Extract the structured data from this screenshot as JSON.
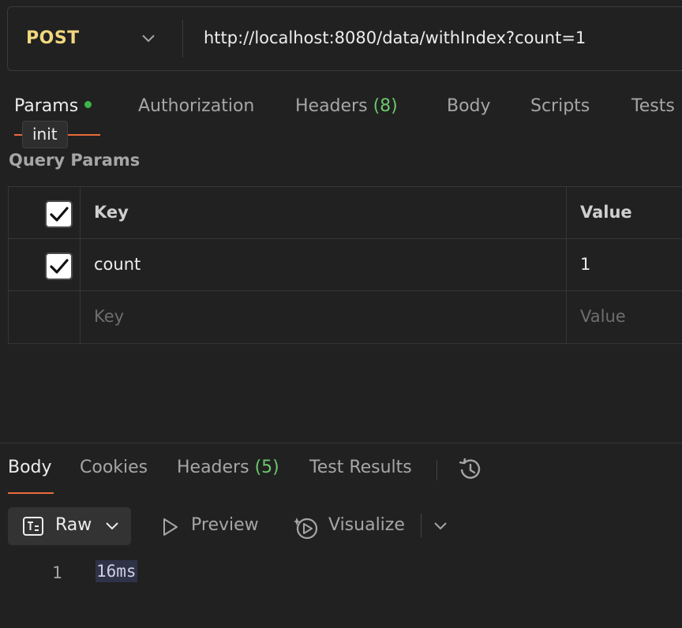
{
  "request": {
    "method": "POST",
    "url": "http://localhost:8080/data/withIndex?count=1"
  },
  "request_tabs": [
    {
      "label": "Params",
      "active": true,
      "has_dot": true
    },
    {
      "label": "Authorization"
    },
    {
      "label": "Headers",
      "count": "(8)"
    },
    {
      "label": "Body"
    },
    {
      "label": "Scripts"
    },
    {
      "label": "Tests"
    }
  ],
  "tooltip": "init",
  "query_params": {
    "title": "Query Params",
    "header": {
      "key": "Key",
      "value": "Value",
      "checked": true
    },
    "rows": [
      {
        "key": "count",
        "value": "1",
        "checked": true
      }
    ],
    "placeholder": {
      "key": "Key",
      "value": "Value"
    }
  },
  "response_tabs": [
    {
      "label": "Body",
      "active": true
    },
    {
      "label": "Cookies"
    },
    {
      "label": "Headers",
      "count": "(5)"
    },
    {
      "label": "Test Results"
    }
  ],
  "response_toolbar": {
    "raw": "Raw",
    "preview": "Preview",
    "visualize": "Visualize"
  },
  "response_body": {
    "line_number": "1",
    "text": "16ms"
  },
  "colors": {
    "method": "#f1d77f",
    "accent": "#e96b3b",
    "count": "#6bc76b",
    "dot": "#3cb54a"
  },
  "icons": [
    "chevron-down-icon",
    "check-icon",
    "history-icon",
    "text-doc-icon",
    "play-icon",
    "visualize-icon"
  ]
}
